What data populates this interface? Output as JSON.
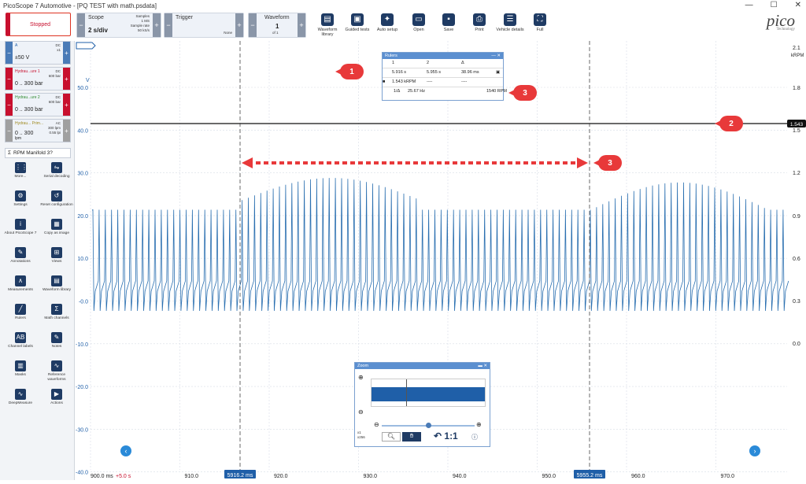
{
  "app": {
    "title": "PicoScope 7 Automotive - [PQ TEST with math.psdata]",
    "logo": "pico",
    "logo_sub": "Technology"
  },
  "toolbar": {
    "run_state": "Stopped",
    "scope": {
      "label": "Scope",
      "timebase": "2 s/div",
      "samples_label": "Samples",
      "samples": "1 MS",
      "rate_label": "Sample rate",
      "rate": "50 kS/s"
    },
    "trigger": {
      "label": "Trigger",
      "mode": "None"
    },
    "waveform": {
      "label": "Waveform",
      "current": "1",
      "of": "of 1"
    },
    "buttons": [
      "Waveform library",
      "Guided tests",
      "Auto setup",
      "Open",
      "Save",
      "Print",
      "Vehicle details",
      "Full"
    ]
  },
  "channels": [
    {
      "name": "A",
      "range": "±50 V",
      "coupling": "DC",
      "probe": "x1",
      "color": "#1f5fa8"
    },
    {
      "name": "Hydrau...ure 1",
      "range": "0 .. 300 bar",
      "coupling": "DC",
      "probe": "600 bar",
      "color": "#c8102e"
    },
    {
      "name": "Hydrau...ure 2",
      "range": "0 .. 300 bar",
      "coupling": "DC",
      "probe": "600 bar",
      "color": "#2e8b2e"
    },
    {
      "name": "Hydrau... Prim...",
      "range": "0 .. 300",
      "unit": "lpm",
      "coupling": "AC",
      "probe": "300 lpm",
      "extra": "0.55 lpi",
      "color": "#a08a20"
    }
  ],
  "math_channel": "RPM Manifold 3?",
  "tools": [
    {
      "icon": "grid-icon",
      "label": "More..."
    },
    {
      "icon": "serial-icon",
      "label": "Serial decoding"
    },
    {
      "icon": "gear-icon",
      "label": "Settings"
    },
    {
      "icon": "reset-icon",
      "label": "Reset configuration"
    },
    {
      "icon": "info-icon",
      "label": "About PicoScope 7"
    },
    {
      "icon": "image-icon",
      "label": "Copy as image"
    },
    {
      "icon": "annotation-icon",
      "label": "Annotations"
    },
    {
      "icon": "views-icon",
      "label": "Views"
    },
    {
      "icon": "measure-icon",
      "label": "Measurements"
    },
    {
      "icon": "library-icon",
      "label": "Waveform library"
    },
    {
      "icon": "ruler-icon",
      "label": "Rulers"
    },
    {
      "icon": "sigma-icon",
      "label": "Math channels"
    },
    {
      "icon": "abcd-icon",
      "label": "Channel labels"
    },
    {
      "icon": "notes-icon",
      "label": "Notes"
    },
    {
      "icon": "mask-icon",
      "label": "Masks"
    },
    {
      "icon": "reference-icon",
      "label": "Reference waveforms"
    },
    {
      "icon": "deepmeasure-icon",
      "label": "DeepMeasure"
    },
    {
      "icon": "actions-icon",
      "label": "Actions"
    }
  ],
  "plot": {
    "left_unit": "V",
    "right_unit": "kRPM",
    "left_ticks": [
      "50.0",
      "40.0",
      "30.0",
      "20.0",
      "10.0",
      "-0.0",
      "-10.0",
      "-20.0",
      "-30.0",
      "-40.0"
    ],
    "right_ticks": [
      "2.1",
      "1.8",
      "1.5",
      "1.2",
      "0.9",
      "0.6",
      "0.3",
      "0.0"
    ],
    "x_ticks": [
      "900.0 ms",
      "910.0",
      "920.0",
      "930.0",
      "940.0",
      "950.0",
      "960.0",
      "970.0"
    ],
    "x_offset": "+5.0 s",
    "ruler1_label": "5916.2 ms",
    "ruler2_label": "5955.2 ms",
    "rpm_marker": "1.543"
  },
  "rulers_dialog": {
    "title": "Rulers",
    "headers": [
      "1",
      "2",
      "Δ"
    ],
    "row_time": [
      "5.916 s",
      "5.955 s",
      "38.96 ms"
    ],
    "row_rpm": [
      "1.543 kRPM",
      "----",
      "----"
    ],
    "freq_label": "1/Δ",
    "freq": "25.67 Hz",
    "rpm": "1540 RPM"
  },
  "zoom_dialog": {
    "title": "Zoom",
    "ratio": "1:1",
    "x_label": "x1",
    "y_label": "x256"
  },
  "callouts": [
    "1",
    "2",
    "3",
    "3"
  ]
}
